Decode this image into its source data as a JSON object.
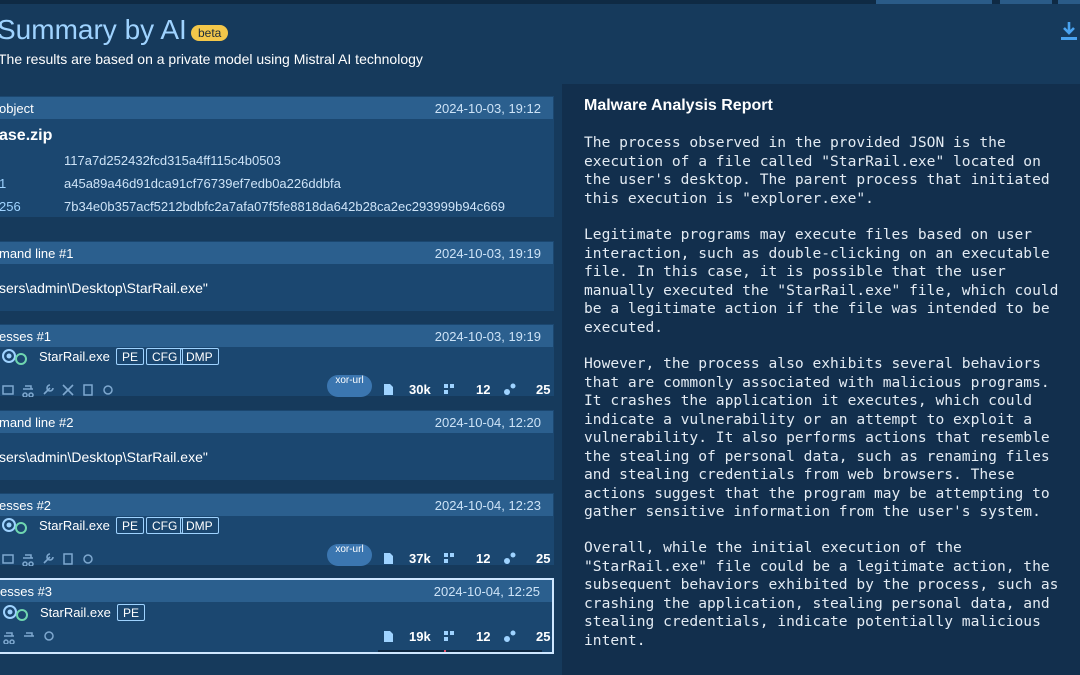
{
  "header": {
    "title": "Summary by AI",
    "beta_badge": "beta",
    "subtitle": "The results are based on a private model using Mistral AI technology"
  },
  "object_panel": {
    "label": "object",
    "timestamp": "2024-10-03, 19:12",
    "file_name": "ase.zip",
    "hashes": [
      {
        "key": "",
        "value": "117a7d252432fcd315a4ff115c4b0503"
      },
      {
        "key": "1",
        "value": "a45a89a46d91dca91cf76739ef7edb0a226ddbfa"
      },
      {
        "key": "256",
        "value": "7b34e0b357acf5212bdbfc2a7afa07f5fe8818da642b28ca2ec293999b94c669"
      }
    ]
  },
  "cmd1": {
    "label": "mand line #1",
    "timestamp": "2024-10-03, 19:19",
    "command": "sers\\admin\\Desktop\\StarRail.exe\""
  },
  "proc1": {
    "label": "esses #1",
    "timestamp": "2024-10-03, 19:19",
    "name": "StarRail.exe",
    "tags": [
      "PE",
      "CFG",
      "DMP"
    ],
    "xor_pill": "xor-url",
    "files": "30k",
    "modules": "12",
    "threads": "25"
  },
  "cmd2": {
    "label": "mand line #2",
    "timestamp": "2024-10-04, 12:20",
    "command": "sers\\admin\\Desktop\\StarRail.exe\""
  },
  "proc2": {
    "label": "esses #2",
    "timestamp": "2024-10-04, 12:23",
    "name": "StarRail.exe",
    "tags": [
      "PE",
      "CFG",
      "DMP"
    ],
    "xor_pill": "xor-url",
    "files": "37k",
    "modules": "12",
    "threads": "25"
  },
  "proc3": {
    "label": "esses #3",
    "timestamp": "2024-10-04, 12:25",
    "name": "StarRail.exe",
    "tags": [
      "PE"
    ],
    "files": "19k",
    "modules": "12",
    "threads": "25"
  },
  "report": {
    "title": "Malware Analysis Report",
    "paragraphs": [
      "The process observed in the provided JSON is the\nexecution of a file called \"StarRail.exe\" located on\nthe user's desktop. The parent process that initiated\nthis execution is \"explorer.exe\".",
      "Legitimate programs may execute files based on user\ninteraction, such as double-clicking on an executable\nfile. In this case, it is possible that the user\nmanually executed the \"StarRail.exe\" file, which could\nbe a legitimate action if the file was intended to be\nexecuted.",
      "However, the process also exhibits several behaviors\nthat are commonly associated with malicious programs.\nIt crashes the application it executes, which could\nindicate a vulnerability or an attempt to exploit a\nvulnerability. It also performs actions that resemble\nthe stealing of personal data, such as renaming files\nand stealing credentials from web browsers. These\nactions suggest that the program may be attempting to\ngather sensitive information from the user's system.",
      "Overall, while the initial execution of the\n\"StarRail.exe\" file could be a legitimate action, the\nsubsequent behaviors exhibited by the process, such as\ncrashing the application, stealing personal data, and\nstealing credentials, indicate potentially malicious\nintent."
    ]
  },
  "colors": {
    "background": "#163a5c",
    "panel": "#1b4770",
    "panel_header": "#2b5f8e",
    "accent": "#9fd3ff",
    "beta": "#f3c74a",
    "report_bg": "#122f4d"
  },
  "icons": [
    "download-icon",
    "process-icon",
    "file-icon",
    "modules-icon",
    "threads-icon",
    "gear-icon",
    "spy-icon",
    "wrench-icon",
    "document-icon",
    "badge-icon"
  ]
}
